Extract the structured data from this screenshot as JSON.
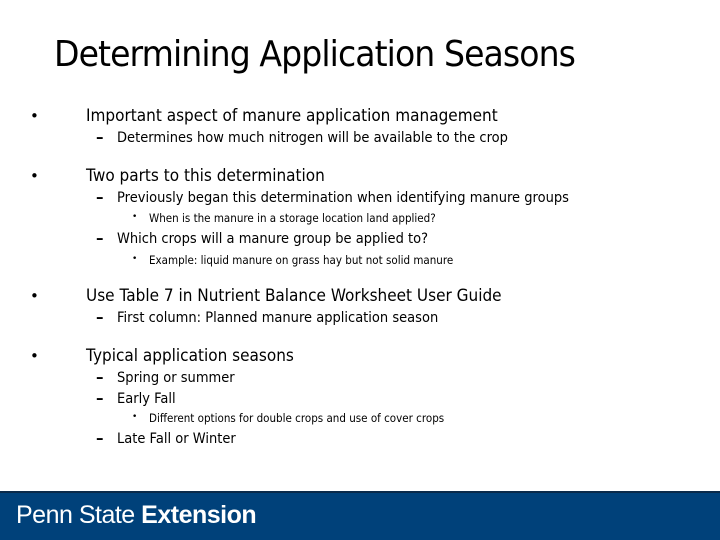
{
  "slide": {
    "title": "Determining Application Seasons",
    "bullets": [
      {
        "text": "Important aspect of manure application management",
        "children": [
          {
            "text": "Determines how much nitrogen will be available to the crop",
            "children": []
          }
        ]
      },
      {
        "text": "Two parts to this determination",
        "children": [
          {
            "text": "Previously began this determination when identifying manure groups",
            "children": [
              {
                "text": "When is the manure in a storage location land applied?"
              }
            ]
          },
          {
            "text": "Which crops will a manure group be applied to?",
            "children": [
              {
                "text": "Example: liquid manure on grass hay but not solid manure"
              }
            ]
          }
        ]
      },
      {
        "text": "Use Table 7 in Nutrient Balance Worksheet User Guide",
        "children": [
          {
            "text": "First column: Planned manure application season",
            "children": []
          }
        ]
      },
      {
        "text": "Typical application seasons",
        "children": [
          {
            "text": "Spring or summer",
            "children": []
          },
          {
            "text": "Early Fall",
            "children": [
              {
                "text": "Different options for double crops and use of cover crops"
              }
            ]
          },
          {
            "text": "Late Fall or Winter",
            "children": []
          }
        ]
      }
    ]
  },
  "markers": {
    "level1": "•",
    "level2": "–",
    "level3": "•"
  },
  "footer": {
    "brand_light": "Penn State",
    "brand_bold": "Extension",
    "background_color": "#00417a"
  }
}
